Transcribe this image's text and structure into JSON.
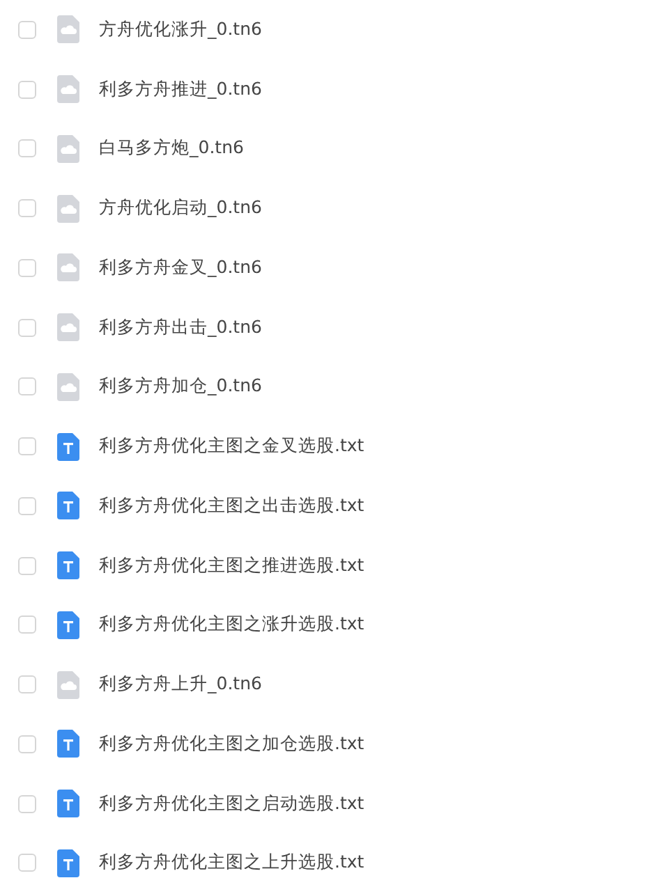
{
  "files": [
    {
      "name": "方舟优化涨升_0.tn6",
      "kind": "tn6",
      "checked": false
    },
    {
      "name": "利多方舟推进_0.tn6",
      "kind": "tn6",
      "checked": false
    },
    {
      "name": "白马多方炮_0.tn6",
      "kind": "tn6",
      "checked": false
    },
    {
      "name": "方舟优化启动_0.tn6",
      "kind": "tn6",
      "checked": false
    },
    {
      "name": "利多方舟金叉_0.tn6",
      "kind": "tn6",
      "checked": false
    },
    {
      "name": "利多方舟出击_0.tn6",
      "kind": "tn6",
      "checked": false
    },
    {
      "name": "利多方舟加仓_0.tn6",
      "kind": "tn6",
      "checked": false
    },
    {
      "name": "利多方舟优化主图之金叉选股.txt",
      "kind": "txt",
      "checked": false
    },
    {
      "name": "利多方舟优化主图之出击选股.txt",
      "kind": "txt",
      "checked": false
    },
    {
      "name": "利多方舟优化主图之推进选股.txt",
      "kind": "txt",
      "checked": false
    },
    {
      "name": "利多方舟优化主图之涨升选股.txt",
      "kind": "txt",
      "checked": false
    },
    {
      "name": "利多方舟上升_0.tn6",
      "kind": "tn6",
      "checked": false
    },
    {
      "name": "利多方舟优化主图之加仓选股.txt",
      "kind": "txt",
      "checked": false
    },
    {
      "name": "利多方舟优化主图之启动选股.txt",
      "kind": "txt",
      "checked": false
    },
    {
      "name": "利多方舟优化主图之上升选股.txt",
      "kind": "txt",
      "checked": false
    }
  ]
}
